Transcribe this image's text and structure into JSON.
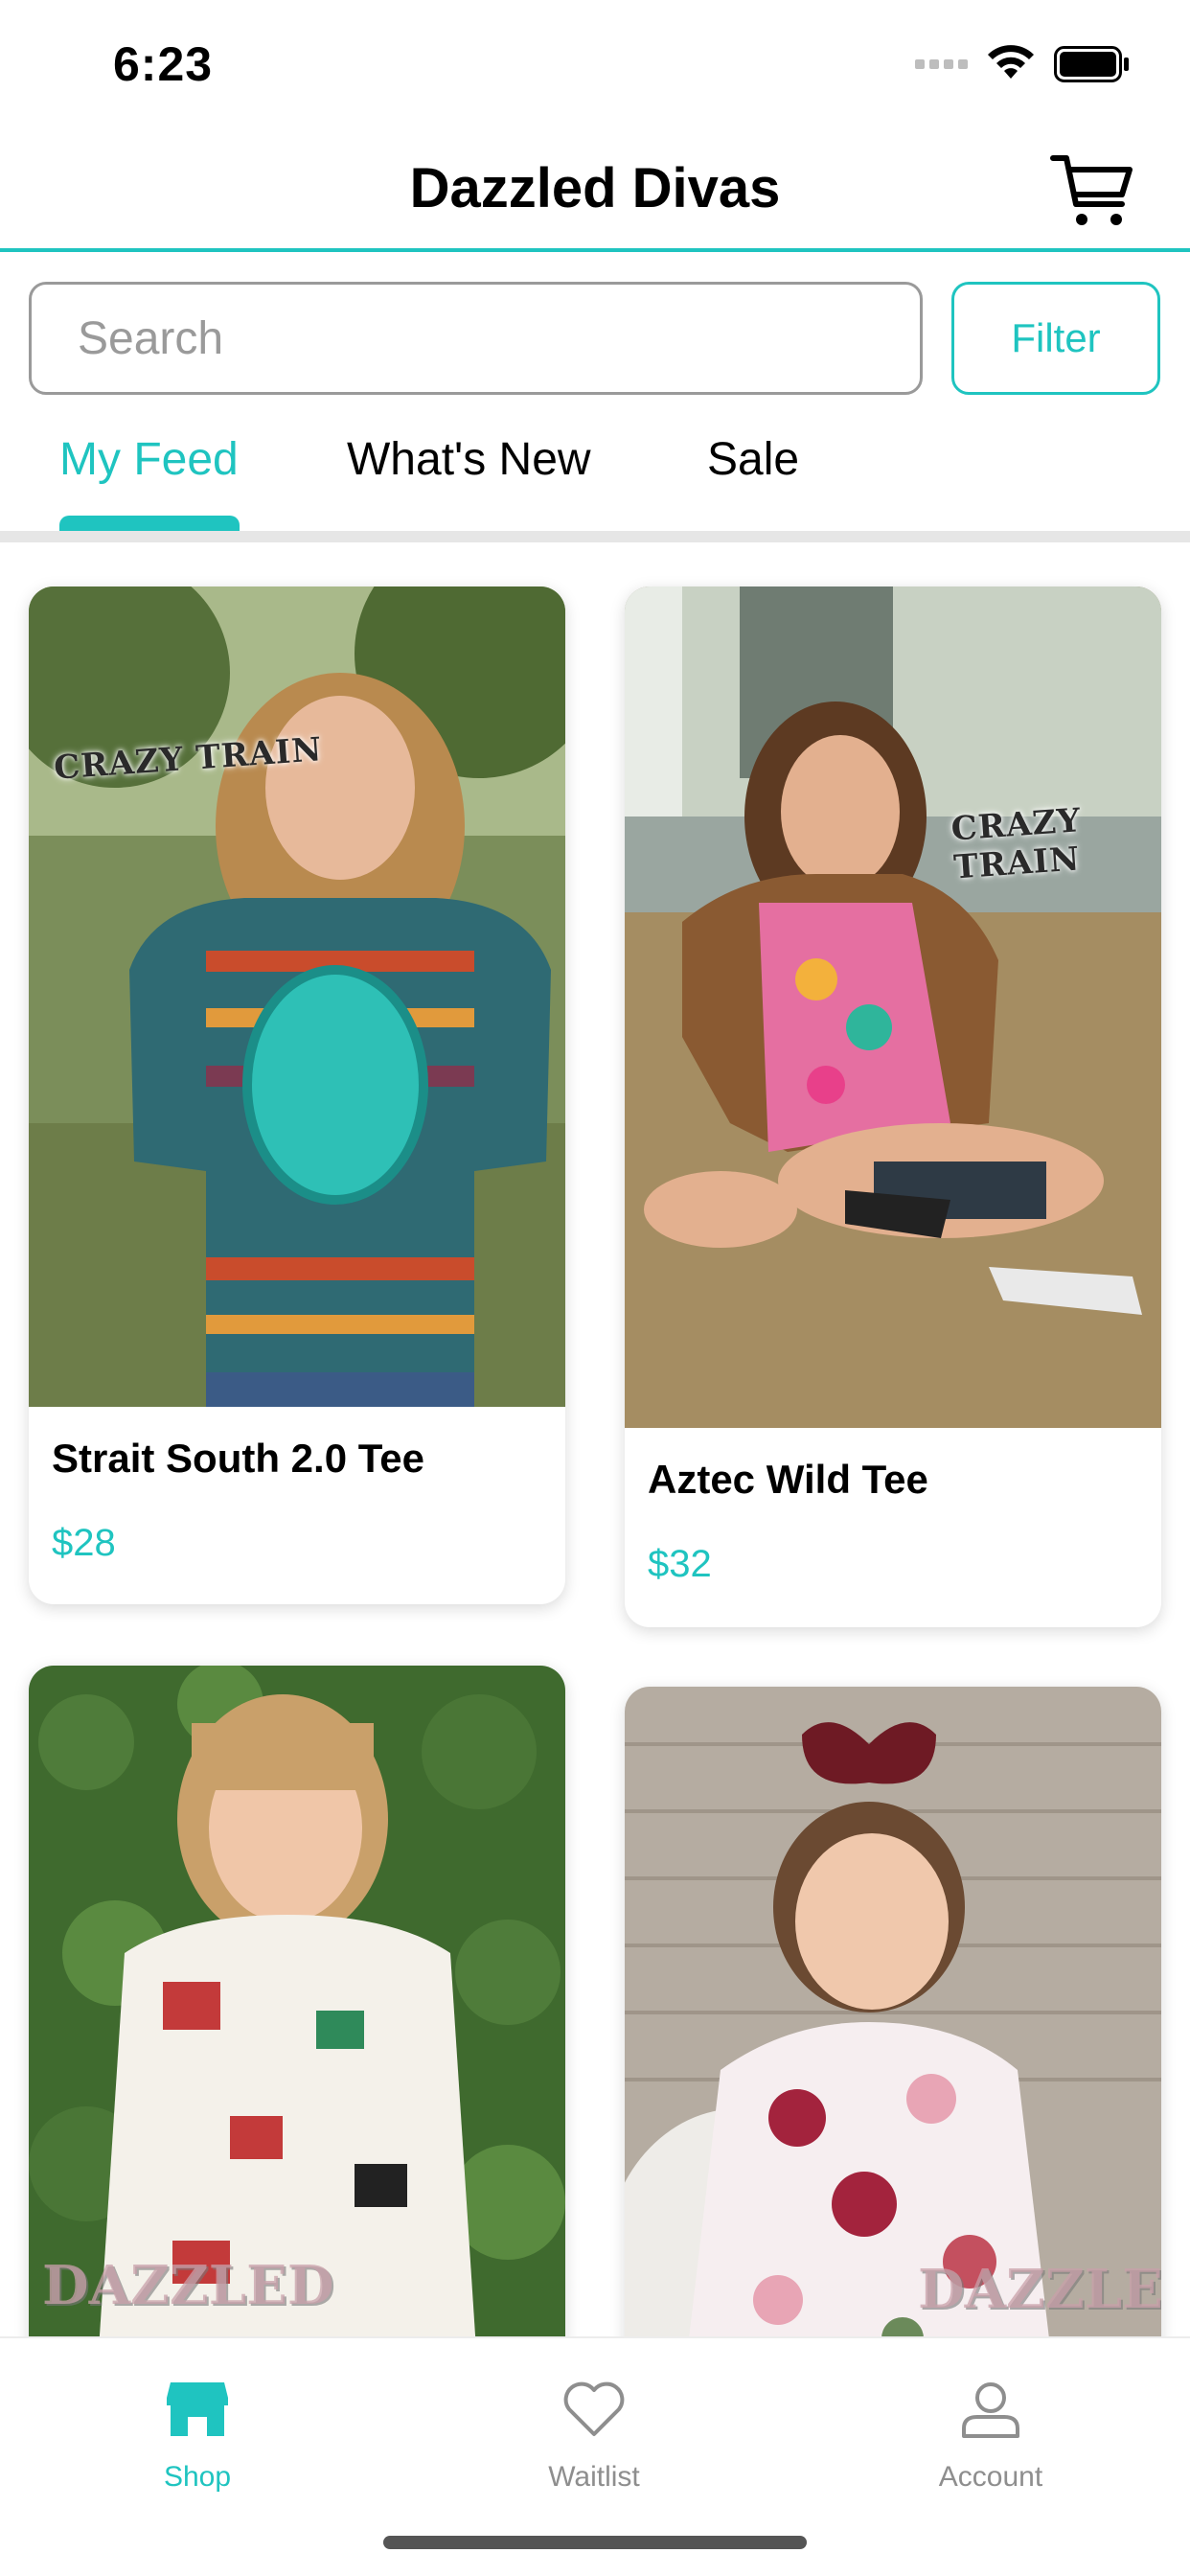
{
  "status_bar": {
    "time": "6:23"
  },
  "header": {
    "title": "Dazzled Divas",
    "cart_icon": "cart-icon"
  },
  "search": {
    "placeholder": "Search",
    "value": ""
  },
  "filter_label": "Filter",
  "tabs": [
    {
      "label": "My Feed",
      "active": true
    },
    {
      "label": "What's New",
      "active": false
    },
    {
      "label": "Sale",
      "active": false
    }
  ],
  "products": [
    {
      "name": "Strait South 2.0 Tee",
      "price": "$28",
      "brand": "CRAZY TRAIN"
    },
    {
      "name": "Aztec Wild Tee",
      "price": "$32",
      "brand": "CRAZY TRAIN"
    },
    {
      "name": "",
      "price": "",
      "brand": "DAZZLED"
    },
    {
      "name": "",
      "price": "",
      "brand": "DAZZLED"
    }
  ],
  "bottom_nav": [
    {
      "label": "Shop",
      "icon": "shop-icon",
      "active": true
    },
    {
      "label": "Waitlist",
      "icon": "heart-icon",
      "active": false
    },
    {
      "label": "Account",
      "icon": "account-icon",
      "active": false
    }
  ],
  "colors": {
    "accent": "#1fc4c0",
    "muted": "#8e8e8e"
  }
}
